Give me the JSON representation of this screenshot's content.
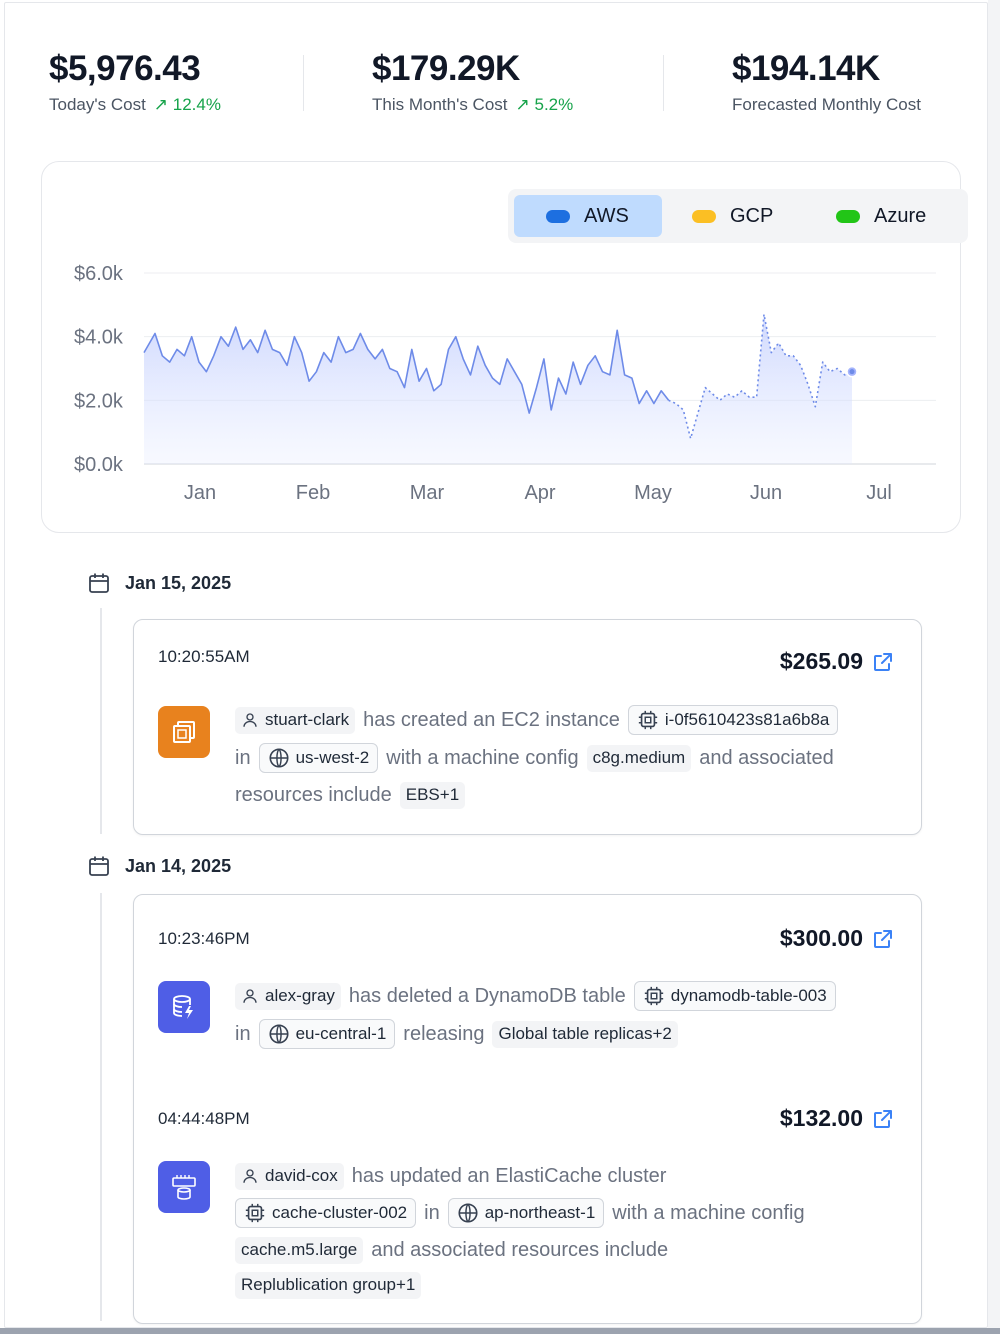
{
  "stats": [
    {
      "value": "$5,976.43",
      "label": "Today's Cost",
      "trend": "↗ 12.4%"
    },
    {
      "value": "$179.29K",
      "label": "This Month's Cost",
      "trend": "↗ 5.2%"
    },
    {
      "value": "$194.14K",
      "label": "Forecasted Monthly Cost",
      "trend": ""
    }
  ],
  "legend": [
    {
      "label": "AWS",
      "color": "#1d6fe0",
      "active": true
    },
    {
      "label": "GCP",
      "color": "#fbbf24",
      "active": false
    },
    {
      "label": "Azure",
      "color": "#22c517",
      "active": false
    }
  ],
  "chart_data": {
    "type": "area",
    "series": [
      {
        "name": "AWS",
        "color": "#6e8be8"
      }
    ],
    "y_ticks": [
      "$6.0k",
      "$4.0k",
      "$2.0k",
      "$0.0k"
    ],
    "y_tick_values": [
      6000,
      4000,
      2000,
      0
    ],
    "ylim": [
      0,
      6000
    ],
    "x_ticks": [
      "Jan",
      "Feb",
      "Mar",
      "Apr",
      "May",
      "Jun",
      "Jul"
    ],
    "xlim": [
      0,
      180
    ],
    "grid": true,
    "actual": [
      [
        0,
        3500
      ],
      [
        3,
        4100
      ],
      [
        5,
        3400
      ],
      [
        7,
        3200
      ],
      [
        9,
        3600
      ],
      [
        11,
        3400
      ],
      [
        13,
        4000
      ],
      [
        15,
        3200
      ],
      [
        17,
        2900
      ],
      [
        19,
        3400
      ],
      [
        21,
        4000
      ],
      [
        23,
        3700
      ],
      [
        25,
        4300
      ],
      [
        27,
        3600
      ],
      [
        29,
        3900
      ],
      [
        31,
        3500
      ],
      [
        33,
        4200
      ],
      [
        35,
        3600
      ],
      [
        37,
        3500
      ],
      [
        39,
        3100
      ],
      [
        41,
        4000
      ],
      [
        43,
        3500
      ],
      [
        45,
        2600
      ],
      [
        47,
        2900
      ],
      [
        49,
        3500
      ],
      [
        51,
        3200
      ],
      [
        53,
        4000
      ],
      [
        55,
        3500
      ],
      [
        57,
        3600
      ],
      [
        59,
        4100
      ],
      [
        61,
        3600
      ],
      [
        63,
        3300
      ],
      [
        65,
        3600
      ],
      [
        67,
        3000
      ],
      [
        69,
        2900
      ],
      [
        71,
        2400
      ],
      [
        73,
        3600
      ],
      [
        75,
        2600
      ],
      [
        77,
        3000
      ],
      [
        79,
        2300
      ],
      [
        81,
        2500
      ],
      [
        83,
        3600
      ],
      [
        85,
        4000
      ],
      [
        87,
        3300
      ],
      [
        89,
        2800
      ],
      [
        91,
        3700
      ],
      [
        93,
        3100
      ],
      [
        95,
        2700
      ],
      [
        97,
        2500
      ],
      [
        99,
        3300
      ],
      [
        101,
        2900
      ],
      [
        103,
        2500
      ],
      [
        105,
        1600
      ],
      [
        107,
        2400
      ],
      [
        109,
        3300
      ],
      [
        111,
        1700
      ],
      [
        113,
        2700
      ],
      [
        115,
        2200
      ],
      [
        117,
        3200
      ],
      [
        119,
        2500
      ],
      [
        121,
        3100
      ],
      [
        123,
        3400
      ],
      [
        125,
        2900
      ],
      [
        127,
        2800
      ],
      [
        129,
        4200
      ],
      [
        131,
        2800
      ],
      [
        133,
        2700
      ],
      [
        135,
        1900
      ],
      [
        137,
        2300
      ],
      [
        139,
        1900
      ],
      [
        141,
        2300
      ],
      [
        143,
        2000
      ]
    ],
    "forecast": [
      [
        143,
        2000
      ],
      [
        145,
        1900
      ],
      [
        147,
        1700
      ],
      [
        149,
        800
      ],
      [
        151,
        1600
      ],
      [
        153,
        2400
      ],
      [
        155,
        2200
      ],
      [
        157,
        2000
      ],
      [
        159,
        2200
      ],
      [
        161,
        2100
      ],
      [
        163,
        2300
      ],
      [
        165,
        2100
      ],
      [
        167,
        2100
      ],
      [
        169,
        4700
      ],
      [
        171,
        3500
      ],
      [
        173,
        3800
      ],
      [
        175,
        3400
      ],
      [
        177,
        3400
      ],
      [
        179,
        3100
      ],
      [
        181,
        2500
      ],
      [
        183,
        1800
      ],
      [
        185,
        3200
      ],
      [
        187,
        2900
      ],
      [
        189,
        3000
      ],
      [
        191,
        2800
      ],
      [
        193,
        2900
      ]
    ]
  },
  "timeline": [
    {
      "date": "Jan 15, 2025",
      "events": [
        {
          "time": "10:20:55AM",
          "cost": "$265.09",
          "icon": "ec2-icon",
          "icon_color": "#e8821e",
          "lines": [
            [
              {
                "chip": "stuart-clark",
                "icon": "user"
              },
              {
                "t": "has created an EC2 instance"
              },
              {
                "chip": "i-0f5610423s81a6b8a",
                "icon": "chip",
                "bordered": true
              }
            ],
            [
              {
                "t": "in"
              },
              {
                "chip": "us-west-2",
                "icon": "globe",
                "bordered": true
              },
              {
                "t": "with a machine config"
              },
              {
                "chip": "c8g.medium"
              },
              {
                "t": "and associated"
              }
            ],
            [
              {
                "t": "resources include"
              },
              {
                "chip": "EBS+1"
              }
            ]
          ]
        }
      ]
    },
    {
      "date": "Jan 14, 2025",
      "events": [
        {
          "time": "10:23:46PM",
          "cost": "$300.00",
          "icon": "dynamodb-icon",
          "icon_color": "#4f5ee6",
          "lines": [
            [
              {
                "chip": "alex-gray",
                "icon": "user"
              },
              {
                "t": "has deleted a DynamoDB table"
              },
              {
                "chip": "dynamodb-table-003",
                "icon": "chip",
                "bordered": true
              }
            ],
            [
              {
                "t": "in"
              },
              {
                "chip": "eu-central-1",
                "icon": "globe",
                "bordered": true
              },
              {
                "t": "releasing"
              },
              {
                "chip": "Global table replicas+2"
              }
            ]
          ]
        },
        {
          "time": "04:44:48PM",
          "cost": "$132.00",
          "icon": "elasticache-icon",
          "icon_color": "#4f5ee6",
          "lines": [
            [
              {
                "chip": "david-cox",
                "icon": "user"
              },
              {
                "t": "has updated an ElastiCache cluster"
              }
            ],
            [
              {
                "chip": "cache-cluster-002",
                "icon": "chip",
                "bordered": true
              },
              {
                "t": "in"
              },
              {
                "chip": "ap-northeast-1",
                "icon": "globe",
                "bordered": true
              },
              {
                "t": "with a machine config"
              }
            ],
            [
              {
                "chip": "cache.m5.large"
              },
              {
                "t": "and associated resources include"
              }
            ],
            [
              {
                "chip": "Replublication group+1"
              }
            ]
          ]
        }
      ]
    }
  ]
}
